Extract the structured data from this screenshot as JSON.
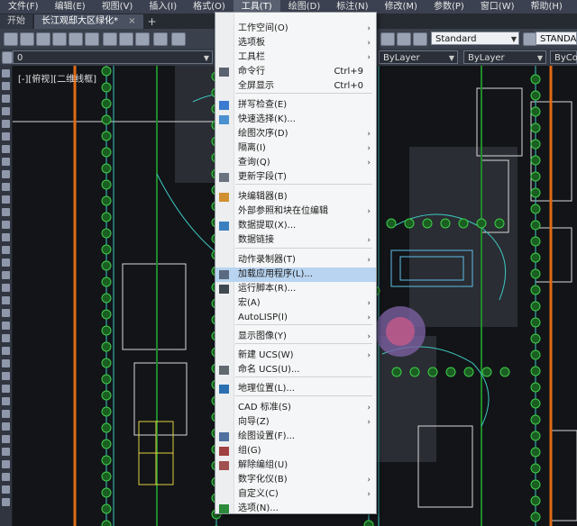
{
  "menubar": [
    "文件(F)",
    "编辑(E)",
    "视图(V)",
    "插入(I)",
    "格式(O)",
    "工具(T)",
    "绘图(D)",
    "标注(N)",
    "修改(M)",
    "参数(P)",
    "窗口(W)",
    "帮助(H)"
  ],
  "tabs": {
    "start": "开始",
    "drawing": "长江观邸大区绿化*",
    "close": "×",
    "add": "+"
  },
  "toolbar": {
    "textstyle": "Standard",
    "dimstyle": "STANDARD"
  },
  "layerbar": {
    "layer": "0",
    "color": "ByLayer",
    "linetype": "ByLayer",
    "plotstyle": "ByColor"
  },
  "viewport": {
    "label": "[-][俯视][二维线框]"
  },
  "menu": {
    "items": [
      {
        "label": "工作空间(O)",
        "submenu": true,
        "icon": ""
      },
      {
        "label": "选项板",
        "submenu": true,
        "icon": ""
      },
      {
        "label": "工具栏",
        "submenu": true,
        "icon": ""
      },
      {
        "label": "命令行",
        "shortcut": "Ctrl+9",
        "icon": "command-line-icon"
      },
      {
        "label": "全屏显示",
        "shortcut": "Ctrl+0",
        "icon": ""
      },
      {
        "label": "拼写检查(E)",
        "icon": "spell-check-icon"
      },
      {
        "label": "快速选择(K)...",
        "icon": "quick-select-icon"
      },
      {
        "label": "绘图次序(D)",
        "submenu": true,
        "icon": ""
      },
      {
        "label": "隔离(I)",
        "submenu": true,
        "icon": ""
      },
      {
        "label": "查询(Q)",
        "submenu": true,
        "icon": ""
      },
      {
        "label": "更新字段(T)",
        "icon": "update-field-icon"
      },
      {
        "label": "块编辑器(B)",
        "icon": "block-editor-icon"
      },
      {
        "label": "外部参照和块在位编辑",
        "submenu": true,
        "icon": ""
      },
      {
        "label": "数据提取(X)...",
        "icon": "data-extraction-icon"
      },
      {
        "label": "数据链接",
        "submenu": true,
        "icon": ""
      },
      {
        "label": "动作录制器(T)",
        "submenu": true,
        "icon": ""
      },
      {
        "label": "加载应用程序(L)...",
        "icon": "load-application-icon",
        "highlighted": true
      },
      {
        "label": "运行脚本(R)...",
        "icon": "run-script-icon"
      },
      {
        "label": "宏(A)",
        "submenu": true,
        "icon": ""
      },
      {
        "label": "AutoLISP(I)",
        "submenu": true,
        "icon": ""
      },
      {
        "label": "显示图像(Y)",
        "submenu": true,
        "icon": ""
      },
      {
        "label": "新建 UCS(W)",
        "submenu": true,
        "icon": ""
      },
      {
        "label": "命名 UCS(U)...",
        "icon": "named-ucs-icon"
      },
      {
        "label": "地理位置(L)...",
        "icon": "geolocation-icon"
      },
      {
        "label": "CAD 标准(S)",
        "submenu": true,
        "icon": ""
      },
      {
        "label": "向导(Z)",
        "submenu": true,
        "icon": ""
      },
      {
        "label": "绘图设置(F)...",
        "icon": "drafting-settings-icon"
      },
      {
        "label": "组(G)",
        "icon": "group-icon"
      },
      {
        "label": "解除编组(U)",
        "icon": "ungroup-icon"
      },
      {
        "label": "数字化仪(B)",
        "submenu": true,
        "icon": ""
      },
      {
        "label": "自定义(C)",
        "submenu": true,
        "icon": ""
      },
      {
        "label": "选项(N)...",
        "icon": "options-check-icon"
      }
    ]
  },
  "colors": {
    "menubar": "#3b4150",
    "canvas": "#121418",
    "highlight": "#b8d4f0",
    "orange": "#e06a14",
    "green": "#2fae3a",
    "cyan": "#3ec7c0"
  }
}
